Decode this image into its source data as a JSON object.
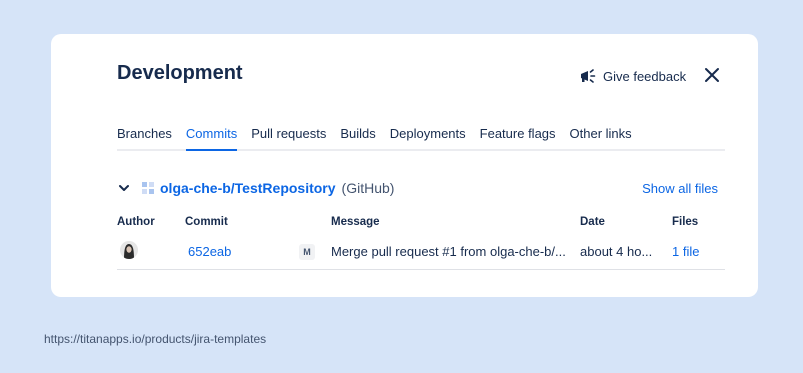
{
  "dialog": {
    "title": "Development",
    "feedback_label": "Give feedback"
  },
  "tabs": [
    {
      "label": "Branches"
    },
    {
      "label": "Commits"
    },
    {
      "label": "Pull requests"
    },
    {
      "label": "Builds"
    },
    {
      "label": "Deployments"
    },
    {
      "label": "Feature flags"
    },
    {
      "label": "Other links"
    }
  ],
  "active_tab": "Commits",
  "repository": {
    "name": "olga-che-b/TestRepository",
    "source": "(GitHub)",
    "show_all_label": "Show all files"
  },
  "table": {
    "headers": {
      "author": "Author",
      "commit": "Commit",
      "message": "Message",
      "date": "Date",
      "files": "Files"
    },
    "rows": [
      {
        "commit": "652eab",
        "badge": "M",
        "message": "Merge pull request #1 from olga-che-b/...",
        "date": "about 4 ho...",
        "files": "1 file"
      }
    ]
  },
  "footer": {
    "url": "https://titanapps.io/products/jira-templates"
  },
  "colors": {
    "background": "#d6e4f8",
    "accent": "#0c66e4",
    "text": "#172b4d"
  },
  "icons": {
    "feedback": "megaphone-icon",
    "close": "close-icon",
    "expand": "chevron-down-icon",
    "repo": "repository-icon",
    "avatar": "avatar"
  }
}
